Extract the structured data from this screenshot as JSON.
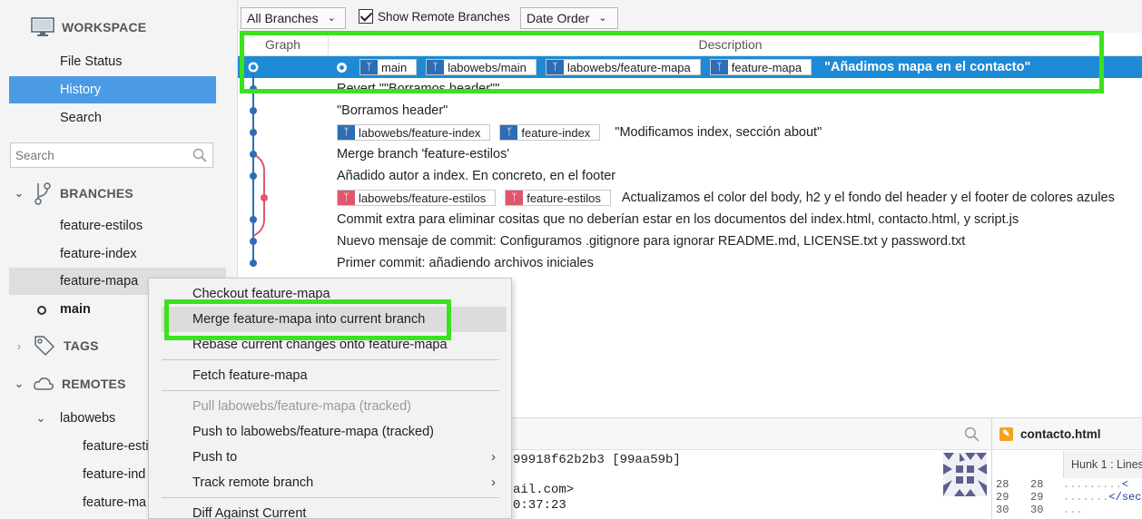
{
  "sidebar": {
    "workspace": {
      "title": "WORKSPACE",
      "items": [
        "File Status",
        "History",
        "Search"
      ]
    },
    "search_placeholder": "Search",
    "branches": {
      "title": "BRANCHES",
      "items": [
        "feature-estilos",
        "feature-index",
        "feature-mapa",
        "main"
      ]
    },
    "tags": {
      "title": "TAGS"
    },
    "remotes": {
      "title": "REMOTES",
      "remote_name": "labowebs",
      "items": [
        "feature-esti",
        "feature-ind",
        "feature-ma"
      ]
    }
  },
  "toolbar": {
    "branches_dropdown": "All Branches",
    "show_remote_label": "Show Remote Branches",
    "order_dropdown": "Date Order"
  },
  "log": {
    "col_graph": "Graph",
    "col_description": "Description",
    "rows": [
      {
        "tags": [
          "main",
          "labowebs/main",
          "labowebs/feature-mapa",
          "feature-mapa"
        ],
        "message": "\"Añadimos mapa en el contacto\""
      },
      {
        "message": "Revert \"\"Borramos header\"\""
      },
      {
        "message": "\"Borramos header\""
      },
      {
        "tags": [
          "labowebs/feature-index",
          "feature-index"
        ],
        "message": "\"Modificamos index, sección about\""
      },
      {
        "message": "Merge branch 'feature-estilos'"
      },
      {
        "message": "Añadido autor a index. En concreto, en el footer"
      },
      {
        "tags": [
          "labowebs/feature-estilos",
          "feature-estilos"
        ],
        "message": "Actualizamos el color del body, h2 y el fondo del header y el footer de colores azules"
      },
      {
        "message": "Commit extra para eliminar cositas que no deberían estar en los documentos del index.html, contacto.html, y script.js"
      },
      {
        "message": "Nuevo mensaje de commit: Configuramos .gitignore para ignorar README.md, LICENSE.txt y password.txt"
      },
      {
        "message": "Primer commit: añadiendo archivos iniciales"
      }
    ]
  },
  "details": {
    "commit_fragment": "99918f62b2b3 [99aa59b]",
    "email_fragment": "ail.com>",
    "time_fragment": "0:37:23"
  },
  "file_panel": {
    "filename": "contacto.html",
    "hunk_label": "Hunk 1 : Lines",
    "line_numbers": [
      [
        "28",
        "28"
      ],
      [
        "29",
        "29"
      ],
      [
        "30",
        "30"
      ]
    ],
    "code_lines": [
      "<",
      "</sec",
      ""
    ]
  },
  "context_menu": {
    "items": [
      "Checkout feature-mapa",
      "Merge feature-mapa into current branch",
      "Rebase current changes onto feature-mapa",
      "Fetch feature-mapa",
      "Pull labowebs/feature-mapa (tracked)",
      "Push to labowebs/feature-mapa (tracked)",
      "Push to",
      "Track remote branch",
      "Diff Against Current"
    ]
  },
  "colors": {
    "selection": "#1e8ad6",
    "sidebar_selection": "#4a9be4",
    "branch_icon_blue": "#2c6db6",
    "branch_icon_red": "#e0566c",
    "annotation_green": "#3be21e"
  }
}
